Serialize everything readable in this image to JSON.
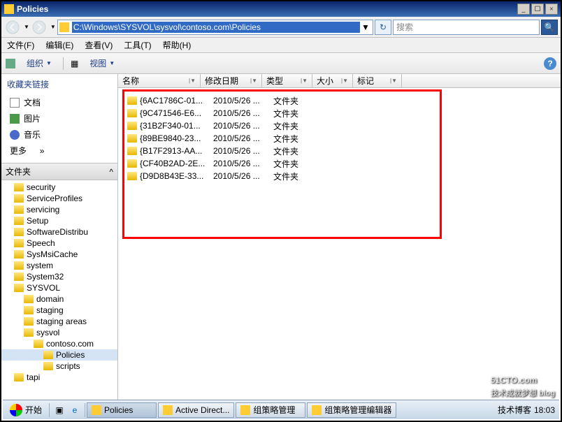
{
  "window": {
    "title": "Policies"
  },
  "winbtns": {
    "min": "_",
    "max": "☐",
    "close": "×"
  },
  "address": {
    "path": "C:\\Windows\\SYSVOL\\sysvol\\contoso.com\\Policies"
  },
  "search": {
    "placeholder": "搜索"
  },
  "menubar": {
    "file": "文件(F)",
    "edit": "编辑(E)",
    "view": "查看(V)",
    "tools": "工具(T)",
    "help": "帮助(H)"
  },
  "toolbar": {
    "organize": "组织",
    "views": "视图"
  },
  "favlinks": {
    "header": "收藏夹链接",
    "documents": "文档",
    "pictures": "图片",
    "music": "音乐",
    "more": "更多",
    "more_arrow": "»"
  },
  "folders": {
    "header": "文件夹",
    "collapse": "^"
  },
  "tree": {
    "items": [
      {
        "indent": 1,
        "label": "security"
      },
      {
        "indent": 1,
        "label": "ServiceProfiles"
      },
      {
        "indent": 1,
        "label": "servicing"
      },
      {
        "indent": 1,
        "label": "Setup"
      },
      {
        "indent": 1,
        "label": "SoftwareDistribu"
      },
      {
        "indent": 1,
        "label": "Speech"
      },
      {
        "indent": 1,
        "label": "SysMsiCache"
      },
      {
        "indent": 1,
        "label": "system"
      },
      {
        "indent": 1,
        "label": "System32"
      },
      {
        "indent": 1,
        "label": "SYSVOL"
      },
      {
        "indent": 2,
        "label": "domain"
      },
      {
        "indent": 2,
        "label": "staging"
      },
      {
        "indent": 2,
        "label": "staging areas"
      },
      {
        "indent": 2,
        "label": "sysvol"
      },
      {
        "indent": 3,
        "label": "contoso.com"
      },
      {
        "indent": 4,
        "label": "Policies",
        "sel": true
      },
      {
        "indent": 4,
        "label": "scripts"
      },
      {
        "indent": 1,
        "label": "tapi"
      }
    ]
  },
  "columns": {
    "name": "名称",
    "date": "修改日期",
    "type": "类型",
    "size": "大小",
    "tag": "标记"
  },
  "files": {
    "rows": [
      {
        "name": "{6AC1786C-01...",
        "date": "2010/5/26 ...",
        "type": "文件夹"
      },
      {
        "name": "{9C471546-E6...",
        "date": "2010/5/26 ...",
        "type": "文件夹"
      },
      {
        "name": "{31B2F340-01...",
        "date": "2010/5/26 ...",
        "type": "文件夹"
      },
      {
        "name": "{89BE9840-23...",
        "date": "2010/5/26 ...",
        "type": "文件夹"
      },
      {
        "name": "{B17F2913-AA...",
        "date": "2010/5/26 ...",
        "type": "文件夹"
      },
      {
        "name": "{CF40B2AD-2E...",
        "date": "2010/5/26 ...",
        "type": "文件夹"
      },
      {
        "name": "{D9D8B43E-33...",
        "date": "2010/5/26 ...",
        "type": "文件夹"
      }
    ]
  },
  "taskbar": {
    "start": "开始",
    "tasks": [
      {
        "label": "Policies",
        "active": true
      },
      {
        "label": "Active Direct..."
      },
      {
        "label": "组策略管理"
      },
      {
        "label": "组策略管理编辑器"
      }
    ],
    "tray": {
      "time": "18:03",
      "brand": "技术博客"
    }
  },
  "watermark": {
    "main": "51CTO.com",
    "sub": "技术成就梦想 blog"
  }
}
